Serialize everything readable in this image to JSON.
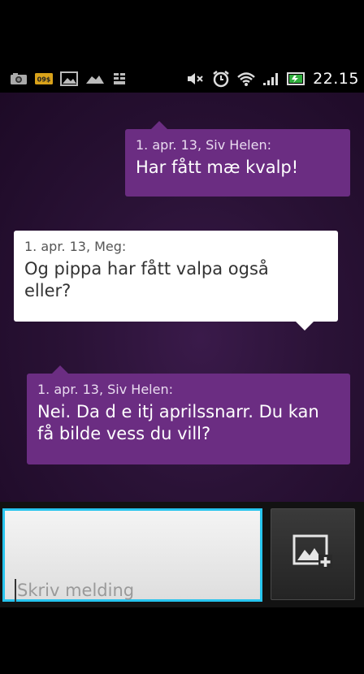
{
  "status_bar": {
    "time": "22.15",
    "left_icons": [
      "camera-icon",
      "sos-icon",
      "picture-icon",
      "cloud-icon",
      "storage-icon"
    ],
    "right_icons": [
      "mute-icon",
      "alarm-icon",
      "wifi-icon",
      "signal-icon",
      "battery-icon"
    ]
  },
  "messages": [
    {
      "direction": "incoming",
      "meta": "1. apr. 13, Siv Helen:",
      "lines": [
        "Har fått mæ kvalp!"
      ]
    },
    {
      "direction": "outgoing",
      "meta": "1. apr. 13, Meg:",
      "lines": [
        "Og pippa har fått valpa også",
        "eller?"
      ]
    },
    {
      "direction": "incoming",
      "meta": "1. apr. 13, Siv Helen:",
      "lines": [
        "Nei. Da d e itj aprilssnarr. Du kan",
        "få bilde vess du vill?"
      ]
    }
  ],
  "composer": {
    "placeholder": "Skriv melding",
    "attach_icon": "add-picture-icon"
  },
  "colors": {
    "incoming_bubble": "#6b2d82",
    "outgoing_bubble": "#ffffff",
    "input_focus_border": "#27c4ee",
    "chat_background": "#2a1236"
  }
}
